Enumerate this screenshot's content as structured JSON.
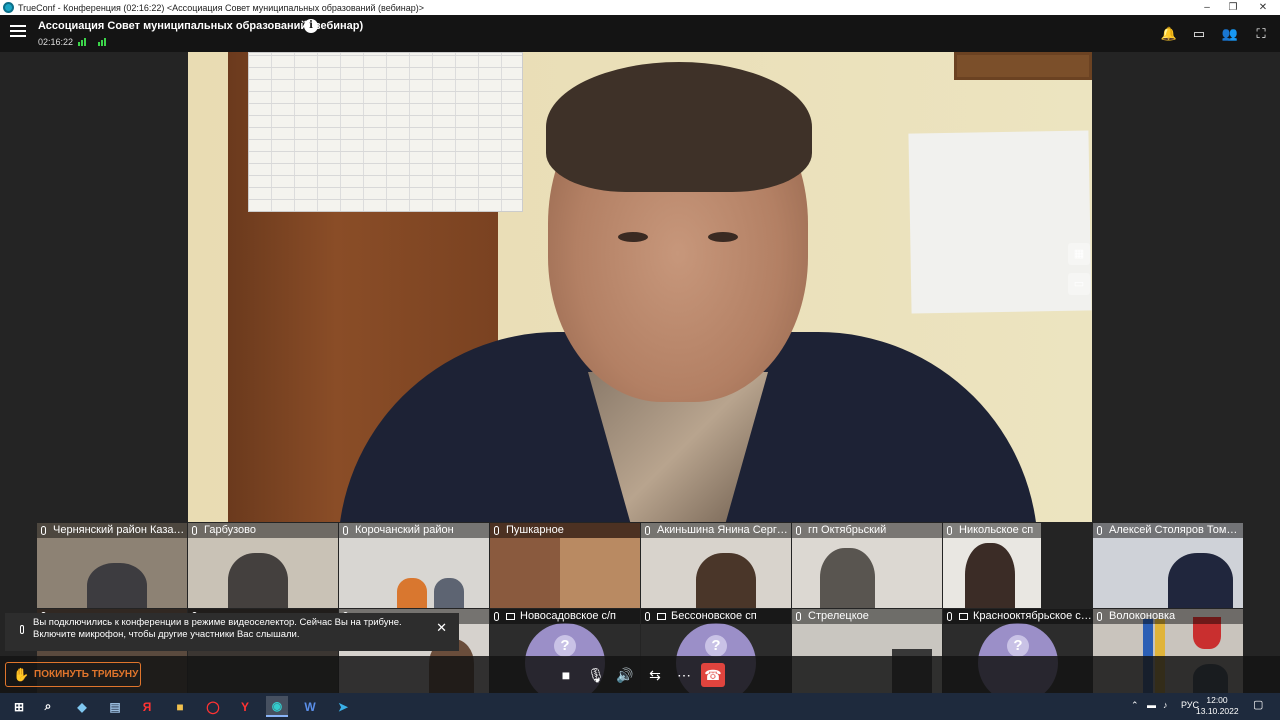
{
  "window": {
    "title": "TrueConf - Конференция (02:16:22) <Ассоциация Совет муниципальных образований (вебинар)>",
    "minimize": "–",
    "maximize": "❐",
    "close": "✕"
  },
  "topbar": {
    "conference_title": "Ассоциация Совет муниципальных образований (вебинар)",
    "elapsed": "02:16:22",
    "info_icon": "i",
    "notifications_icon": "bell-icon",
    "chat_icon": "chat-icon",
    "participants_icon": "participants-icon",
    "fullscreen_icon": "fullscreen-icon",
    "signal_color": "#3cd44a"
  },
  "main_video": {
    "speaker": "active-speaker-video"
  },
  "participants_row1": [
    {
      "name": "Чернянский район Казачья"
    },
    {
      "name": "Гарбузово"
    },
    {
      "name": "Корочанский район"
    },
    {
      "name": "Пушкарное"
    },
    {
      "name": "Акиньшина Янина Сергеевна"
    },
    {
      "name": "гп Октябрьский"
    },
    {
      "name": "Никольское сп"
    },
    {
      "name": "Алексей Столяров Томаровка"
    }
  ],
  "participants_row2": [
    {
      "name": ""
    },
    {
      "name": ""
    },
    {
      "name": ""
    },
    {
      "name": "Новосадовское с/п"
    },
    {
      "name": "Бессоновское сп"
    },
    {
      "name": "Стрелецкое"
    },
    {
      "name": "Краснооктябрьское сельское поселение"
    },
    {
      "name": "Волоконовка"
    }
  ],
  "avatar_placeholder": "?",
  "toast": {
    "line1": "Вы подключились к конференции в режиме видеоселектор. Сейчас Вы на трибуне.",
    "line2": "Включите микрофон, чтобы другие участники Вас слышали.",
    "close": "✕"
  },
  "controls": {
    "leave_podium": "ПОКИНУТЬ ТРИБУНУ",
    "accent": "#e0752c",
    "hangup_color": "#e0443e"
  },
  "taskbar": {
    "lang": "РУС",
    "time": "12:00",
    "date": "13.10.2022"
  }
}
